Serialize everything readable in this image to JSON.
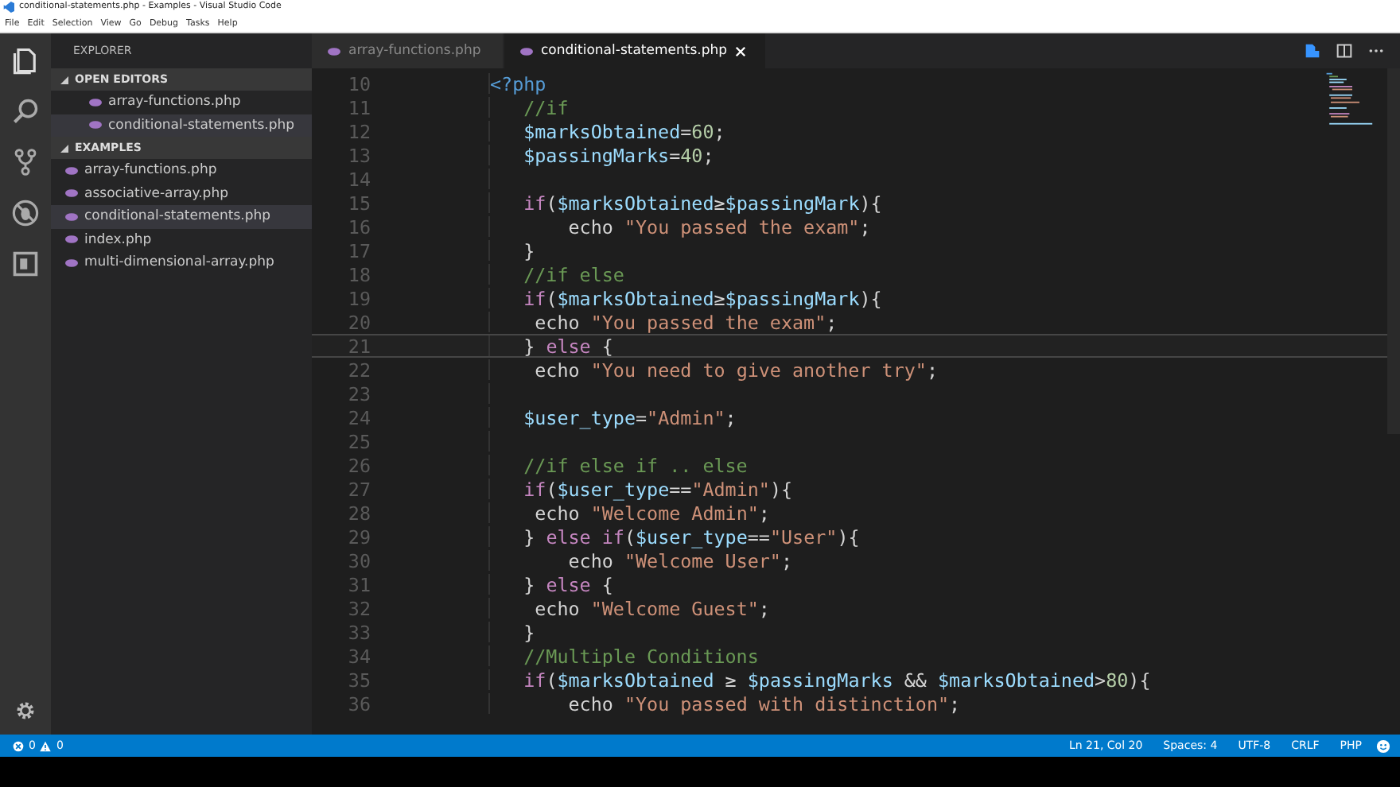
{
  "window": {
    "title": "conditional-statements.php - Examples - Visual Studio Code"
  },
  "menu": [
    "File",
    "Edit",
    "Selection",
    "View",
    "Go",
    "Debug",
    "Tasks",
    "Help"
  ],
  "sidebar": {
    "title": "EXPLORER",
    "sections": [
      {
        "title": "OPEN EDITORS",
        "expanded": true,
        "items": [
          {
            "label": "array-functions.php",
            "selected": false
          },
          {
            "label": "conditional-statements.php",
            "selected": true
          }
        ]
      },
      {
        "title": "EXAMPLES",
        "expanded": true,
        "items": [
          {
            "label": "array-functions.php",
            "selected": false
          },
          {
            "label": "associative-array.php",
            "selected": false
          },
          {
            "label": "conditional-statements.php",
            "selected": true
          },
          {
            "label": "index.php",
            "selected": false
          },
          {
            "label": "multi-dimensional-array.php",
            "selected": false
          }
        ]
      }
    ]
  },
  "tabs": [
    {
      "label": "array-functions.php",
      "selected": false
    },
    {
      "label": "conditional-statements.php",
      "selected": true
    }
  ],
  "code": [
    {
      "number": "10",
      "current": false,
      "tokens": [
        {
          "kind": "tag",
          "text": "<?php"
        }
      ]
    },
    {
      "number": "11",
      "current": false,
      "tokens": [
        {
          "kind": "comment",
          "text": "   //if"
        }
      ]
    },
    {
      "number": "12",
      "current": false,
      "tokens": [
        {
          "kind": "var",
          "text": "   $marksObtained"
        },
        {
          "kind": "plain",
          "text": "="
        },
        {
          "kind": "num",
          "text": "60"
        },
        {
          "kind": "plain",
          "text": ";"
        }
      ]
    },
    {
      "number": "13",
      "current": false,
      "tokens": [
        {
          "kind": "var",
          "text": "   $passingMarks"
        },
        {
          "kind": "plain",
          "text": "="
        },
        {
          "kind": "num",
          "text": "40"
        },
        {
          "kind": "plain",
          "text": ";"
        }
      ]
    },
    {
      "number": "14",
      "current": false
    },
    {
      "number": "15",
      "current": false,
      "tokens": [
        {
          "kind": "kw",
          "text": "   if"
        },
        {
          "kind": "plain",
          "text": "("
        },
        {
          "kind": "var",
          "text": "$marksObtained"
        },
        {
          "kind": "plain",
          "text": "≥"
        },
        {
          "kind": "var",
          "text": "$passingMark"
        },
        {
          "kind": "plain",
          "text": "){"
        }
      ]
    },
    {
      "number": "16",
      "current": false,
      "tokens": [
        {
          "kind": "plain",
          "text": "       echo "
        },
        {
          "kind": "str",
          "text": "\"You passed the exam\""
        },
        {
          "kind": "plain",
          "text": ";"
        }
      ]
    },
    {
      "number": "17",
      "current": false,
      "tokens": [
        {
          "kind": "plain",
          "text": "   }"
        }
      ]
    },
    {
      "number": "18",
      "current": false,
      "tokens": [
        {
          "kind": "comment",
          "text": "   //if else"
        }
      ]
    },
    {
      "number": "19",
      "current": false,
      "tokens": [
        {
          "kind": "kw",
          "text": "   if"
        },
        {
          "kind": "plain",
          "text": "("
        },
        {
          "kind": "var",
          "text": "$marksObtained"
        },
        {
          "kind": "plain",
          "text": "≥"
        },
        {
          "kind": "var",
          "text": "$passingMark"
        },
        {
          "kind": "plain",
          "text": "){"
        }
      ]
    },
    {
      "number": "20",
      "current": false,
      "tokens": [
        {
          "kind": "plain",
          "text": "    echo "
        },
        {
          "kind": "str",
          "text": "\"You passed the exam\""
        },
        {
          "kind": "plain",
          "text": ";"
        }
      ]
    },
    {
      "number": "21",
      "current": true,
      "tokens": [
        {
          "kind": "plain",
          "text": "   } "
        },
        {
          "kind": "kw",
          "text": "else"
        },
        {
          "kind": "plain",
          "text": " {"
        }
      ]
    },
    {
      "number": "22",
      "current": false,
      "tokens": [
        {
          "kind": "plain",
          "text": "    echo "
        },
        {
          "kind": "str",
          "text": "\"You need to give another try\""
        },
        {
          "kind": "plain",
          "text": ";"
        }
      ]
    },
    {
      "number": "23",
      "current": false
    },
    {
      "number": "24",
      "current": false,
      "tokens": [
        {
          "kind": "var",
          "text": "   $user_type"
        },
        {
          "kind": "plain",
          "text": "="
        },
        {
          "kind": "str",
          "text": "\"Admin\""
        },
        {
          "kind": "plain",
          "text": ";"
        }
      ]
    },
    {
      "number": "25",
      "current": false
    },
    {
      "number": "26",
      "current": false,
      "tokens": [
        {
          "kind": "comment",
          "text": "   //if else if .. else"
        }
      ]
    },
    {
      "number": "27",
      "current": false,
      "tokens": [
        {
          "kind": "kw",
          "text": "   if"
        },
        {
          "kind": "plain",
          "text": "("
        },
        {
          "kind": "var",
          "text": "$user_type"
        },
        {
          "kind": "plain",
          "text": "=="
        },
        {
          "kind": "str",
          "text": "\"Admin\""
        },
        {
          "kind": "plain",
          "text": "){"
        }
      ]
    },
    {
      "number": "28",
      "current": false,
      "tokens": [
        {
          "kind": "plain",
          "text": "    echo "
        },
        {
          "kind": "str",
          "text": "\"Welcome Admin\""
        },
        {
          "kind": "plain",
          "text": ";"
        }
      ]
    },
    {
      "number": "29",
      "current": false,
      "tokens": [
        {
          "kind": "plain",
          "text": "   } "
        },
        {
          "kind": "kw",
          "text": "else if"
        },
        {
          "kind": "plain",
          "text": "("
        },
        {
          "kind": "var",
          "text": "$user_type"
        },
        {
          "kind": "plain",
          "text": "=="
        },
        {
          "kind": "str",
          "text": "\"User\""
        },
        {
          "kind": "plain",
          "text": "){"
        }
      ]
    },
    {
      "number": "30",
      "current": false,
      "tokens": [
        {
          "kind": "plain",
          "text": "       echo "
        },
        {
          "kind": "str",
          "text": "\"Welcome User\""
        },
        {
          "kind": "plain",
          "text": ";"
        }
      ]
    },
    {
      "number": "31",
      "current": false,
      "tokens": [
        {
          "kind": "plain",
          "text": "   } "
        },
        {
          "kind": "kw",
          "text": "else"
        },
        {
          "kind": "plain",
          "text": " {"
        }
      ]
    },
    {
      "number": "32",
      "current": false,
      "tokens": [
        {
          "kind": "plain",
          "text": "    echo "
        },
        {
          "kind": "str",
          "text": "\"Welcome Guest\""
        },
        {
          "kind": "plain",
          "text": ";"
        }
      ]
    },
    {
      "number": "33",
      "current": false,
      "tokens": [
        {
          "kind": "plain",
          "text": "   }"
        }
      ]
    },
    {
      "number": "34",
      "current": false,
      "tokens": [
        {
          "kind": "comment",
          "text": "   //Multiple Conditions"
        }
      ]
    },
    {
      "number": "35",
      "current": false,
      "tokens": [
        {
          "kind": "kw",
          "text": "   if"
        },
        {
          "kind": "plain",
          "text": "("
        },
        {
          "kind": "var",
          "text": "$marksObtained"
        },
        {
          "kind": "plain",
          "text": " ≥ "
        },
        {
          "kind": "var",
          "text": "$passingMarks"
        },
        {
          "kind": "plain",
          "text": " && "
        },
        {
          "kind": "var",
          "text": "$marksObtained"
        },
        {
          "kind": "plain",
          "text": ">"
        },
        {
          "kind": "num",
          "text": "80"
        },
        {
          "kind": "plain",
          "text": "){"
        }
      ]
    },
    {
      "number": "36",
      "current": false,
      "tokens": [
        {
          "kind": "plain",
          "text": "       echo "
        },
        {
          "kind": "str",
          "text": "\"You passed with distinction\""
        },
        {
          "kind": "plain",
          "text": ";"
        }
      ]
    }
  ],
  "status_bar": {
    "errors": "0",
    "warnings": "0",
    "items": [
      "Ln 21, Col 20",
      "Spaces: 4",
      "UTF-8",
      "CRLF",
      "PHP"
    ]
  }
}
